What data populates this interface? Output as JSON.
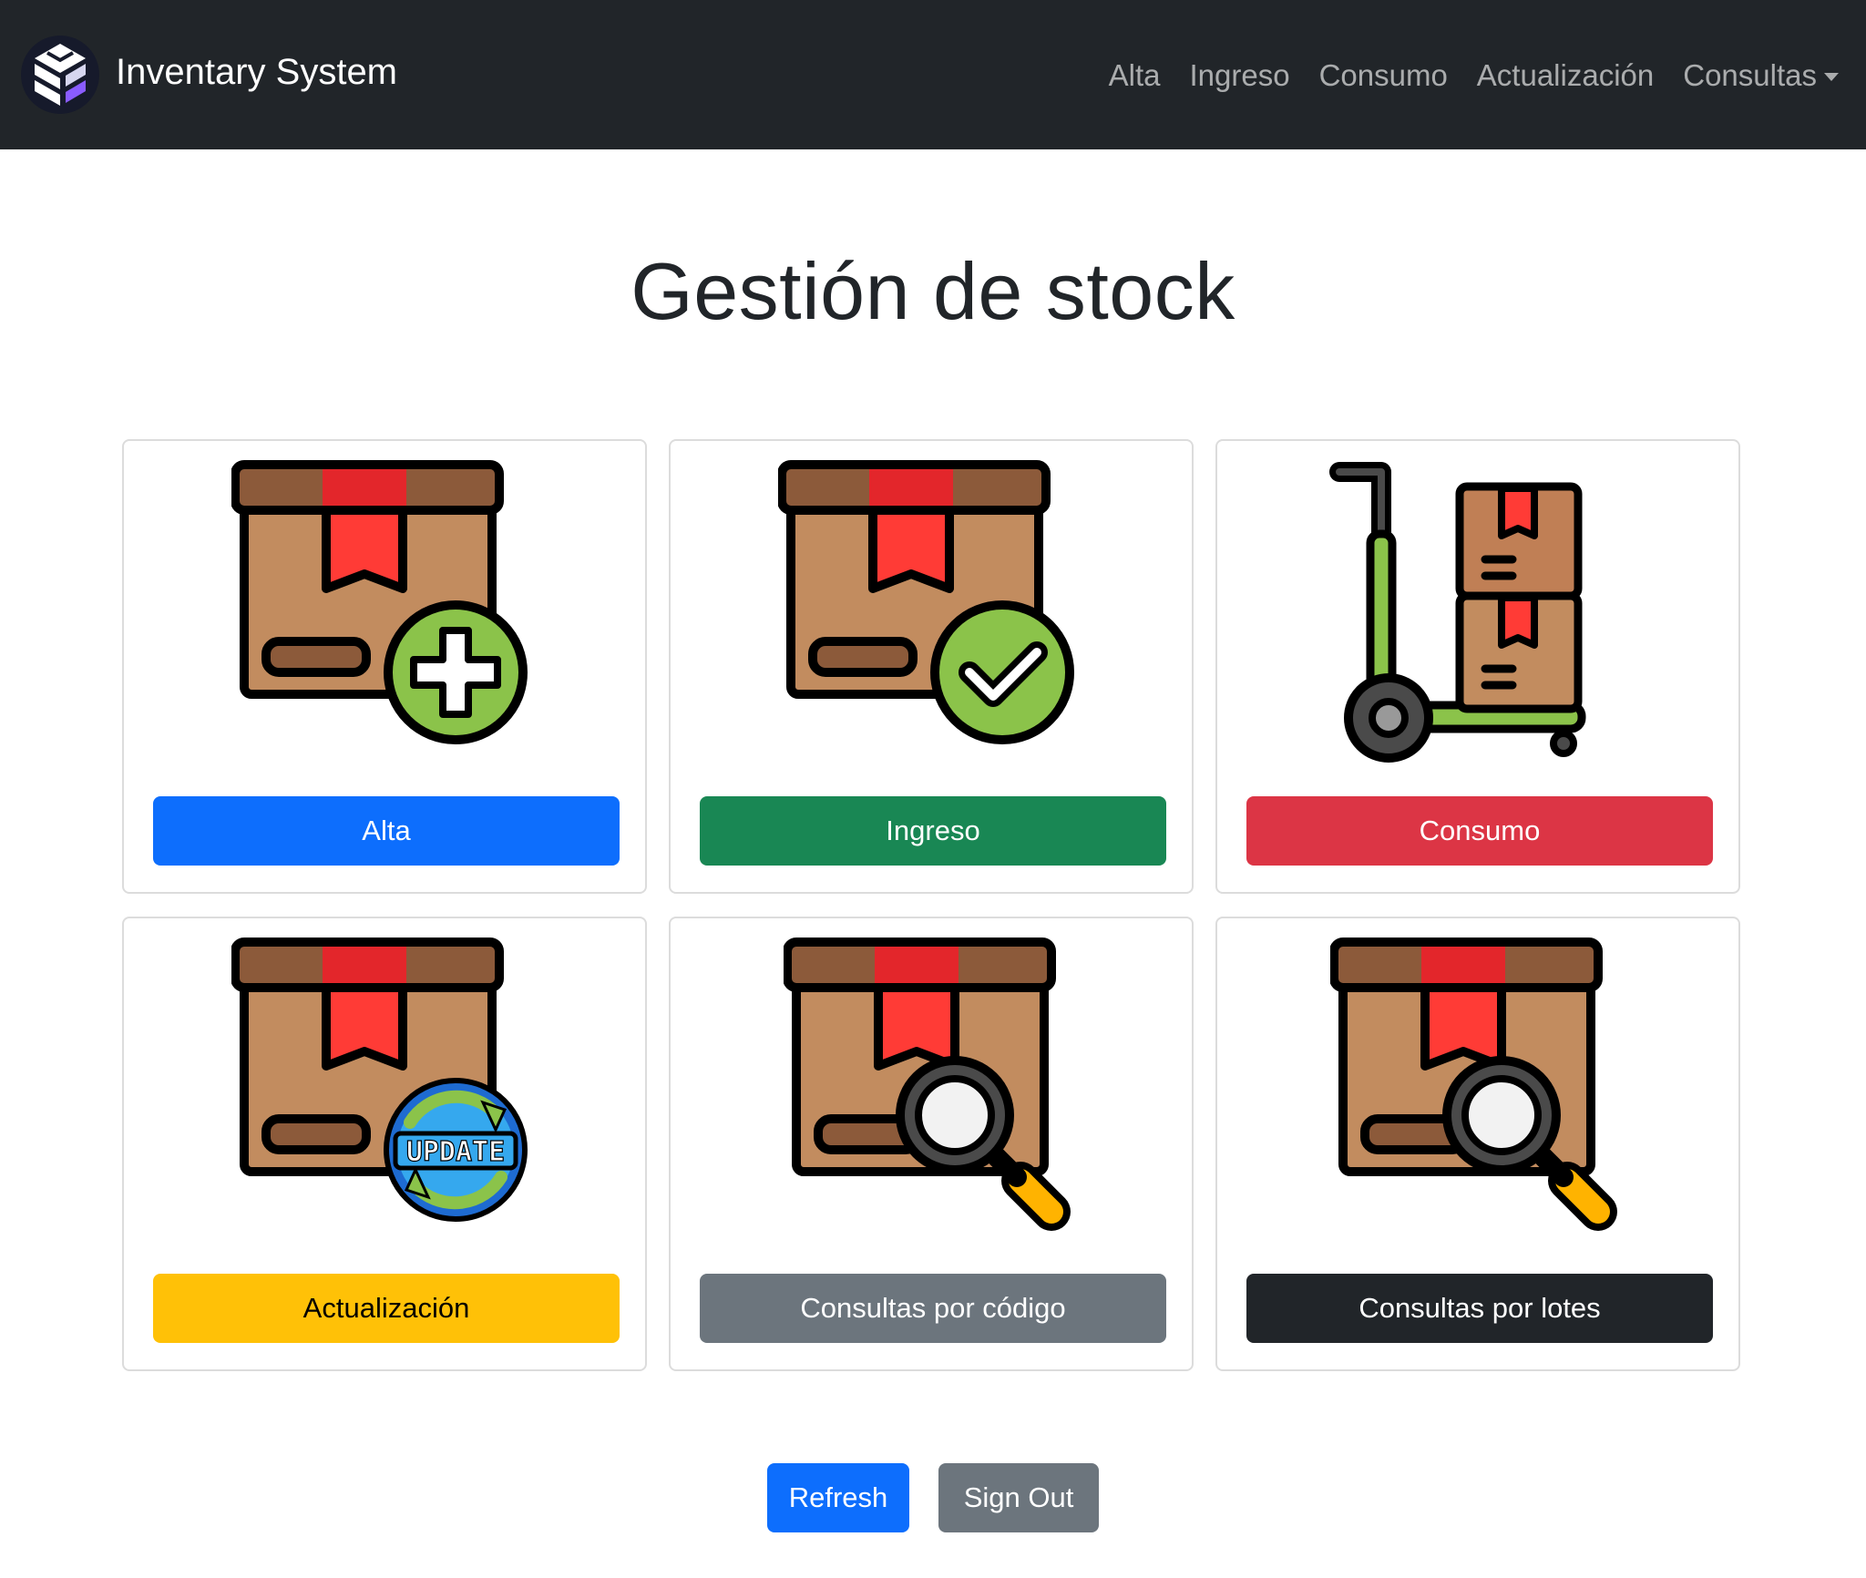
{
  "navbar": {
    "brand": "Inventary System",
    "links": [
      "Alta",
      "Ingreso",
      "Consumo",
      "Actualización"
    ],
    "dropdown_label": "Consultas"
  },
  "main": {
    "title": "Gestión de stock"
  },
  "cards": [
    {
      "label": "Alta",
      "icon": "box-add-icon",
      "color": "#0d6efd"
    },
    {
      "label": "Ingreso",
      "icon": "box-check-icon",
      "color": "#198754"
    },
    {
      "label": "Consumo",
      "icon": "hand-truck-icon",
      "color": "#dc3545"
    },
    {
      "label": "Actualización",
      "icon": "box-update-icon",
      "color": "#ffc107"
    },
    {
      "label": "Consultas por código",
      "icon": "box-search-icon",
      "color": "#6c757d"
    },
    {
      "label": "Consultas por lotes",
      "icon": "box-search-icon",
      "color": "#212529"
    }
  ],
  "actions": {
    "refresh": "Refresh",
    "sign_out": "Sign Out"
  },
  "icon_badge_text": "UPDATE"
}
